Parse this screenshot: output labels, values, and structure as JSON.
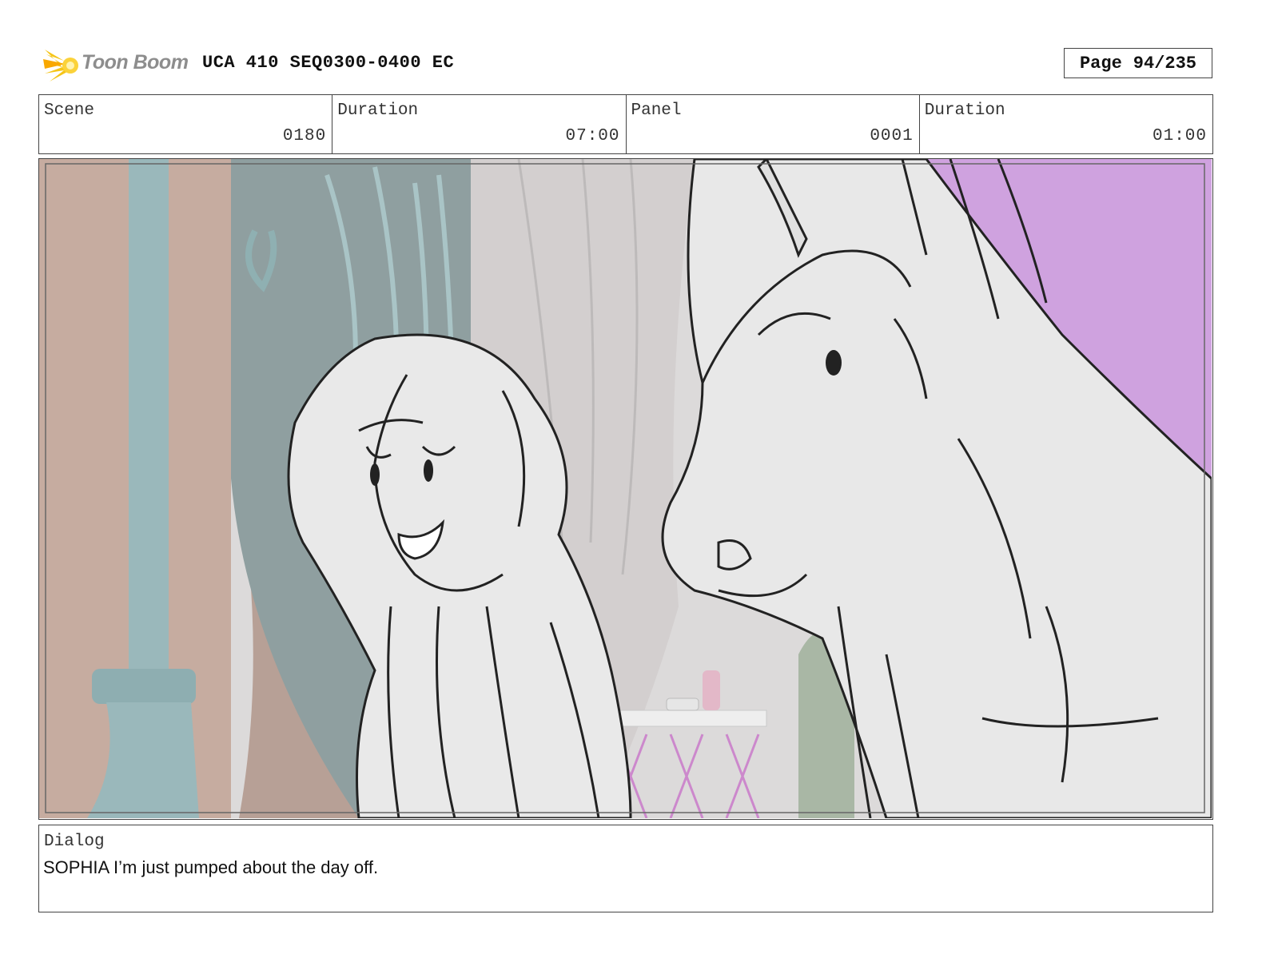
{
  "header": {
    "logo_text": "Toon Boom",
    "doc_title": "UCA 410 SEQ0300-0400 EC",
    "page_label": "Page",
    "page_value": "94/235"
  },
  "info": {
    "scene_label": "Scene",
    "scene_value": "0180",
    "duration_label": "Duration",
    "duration_value": "07:00",
    "panel_label": "Panel",
    "panel_value": "0001",
    "panel_duration_label": "Duration",
    "panel_duration_value": "01:00"
  },
  "dialog": {
    "label": "Dialog",
    "text": "SOPHIA I’m just pumped about the day off."
  },
  "colors": {
    "purple_bg": "#cfa2df",
    "curtain_tan": "#c6aca0",
    "teal_window": "#8f9fa0",
    "pillar_teal": "#9ab8bb",
    "wall_gray": "#dcdada",
    "sketch_fill": "#ececec",
    "logo_yellow": "#f5c518"
  }
}
